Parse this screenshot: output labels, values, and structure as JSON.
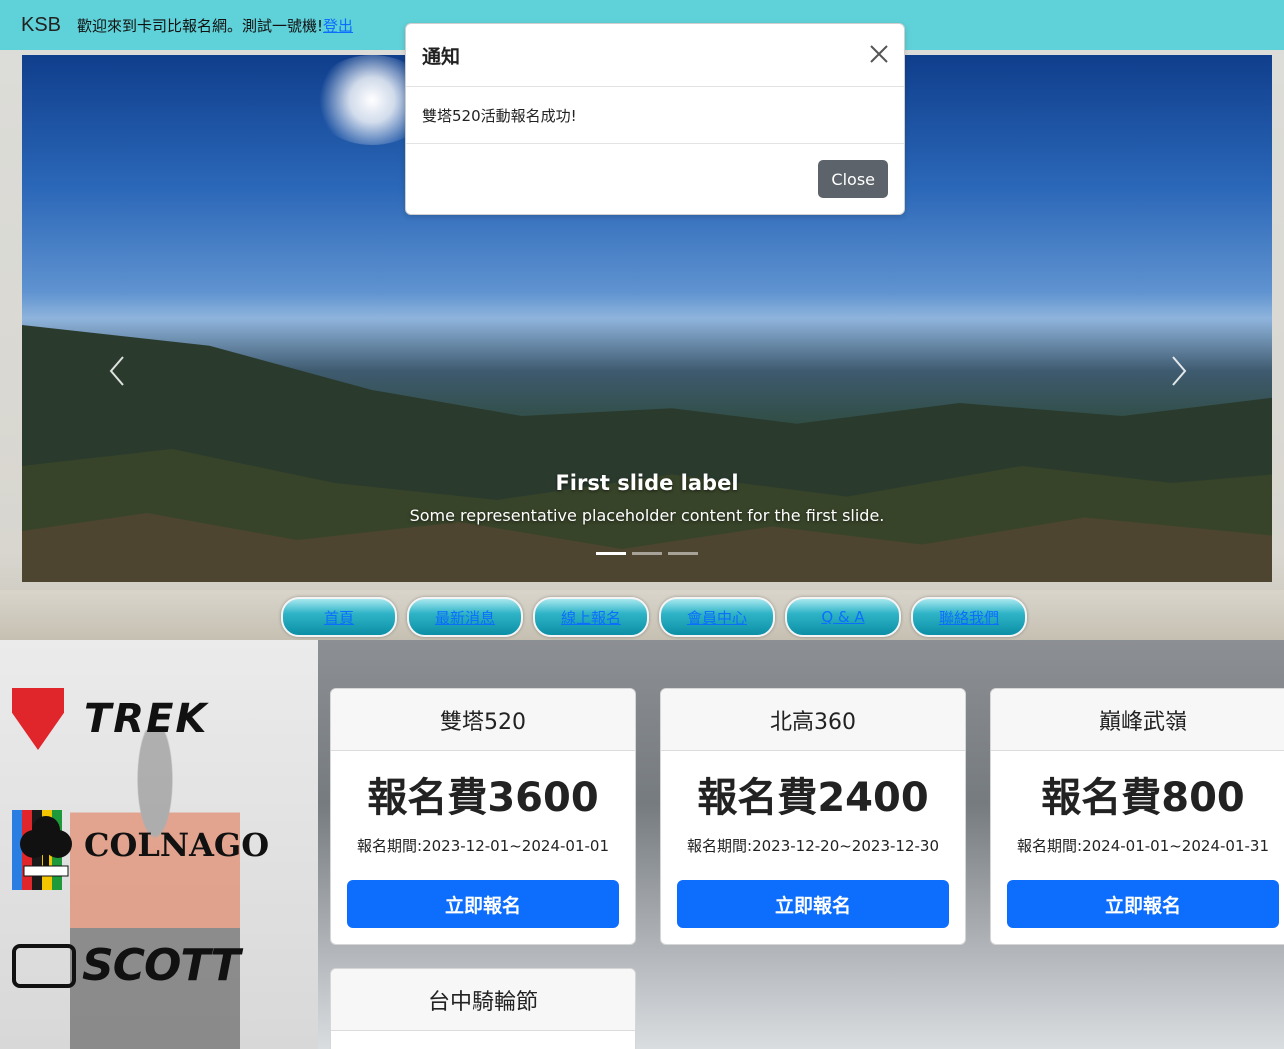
{
  "header": {
    "brand": "KSB",
    "welcome": "歡迎來到卡司比報名網。測試一號機!",
    "logout_label": "登出"
  },
  "carousel": {
    "slide_title": "First slide label",
    "slide_text": "Some representative placeholder content for the first slide.",
    "prev_icon": "chevron-left-icon",
    "next_icon": "chevron-right-icon",
    "active_index": 0,
    "slide_count": 3
  },
  "nav": {
    "items": [
      "首頁",
      "最新消息",
      "線上報名",
      "會員中心",
      "Q & A",
      "聯絡我們"
    ]
  },
  "sponsors": {
    "trek": "TREK",
    "colnago": "COLNAGO",
    "scott": "SCOTT"
  },
  "events": [
    {
      "name": "雙塔520",
      "fee": "報名費3600",
      "period": "報名期間:2023-12-01~2024-01-01",
      "button": "立即報名"
    },
    {
      "name": "北高360",
      "fee": "報名費2400",
      "period": "報名期間:2023-12-20~2023-12-30",
      "button": "立即報名"
    },
    {
      "name": "巔峰武嶺",
      "fee": "報名費800",
      "period": "報名期間:2024-01-01~2024-01-31",
      "button": "立即報名"
    },
    {
      "name": "台中騎輪節"
    }
  ],
  "modal": {
    "title": "通知",
    "message": "雙塔520活動報名成功!",
    "close_label": "Close",
    "close_icon": "close-icon"
  },
  "colors": {
    "topbar": "#5fd1d8",
    "primary": "#0d6efd",
    "close_button": "#5c636a"
  }
}
